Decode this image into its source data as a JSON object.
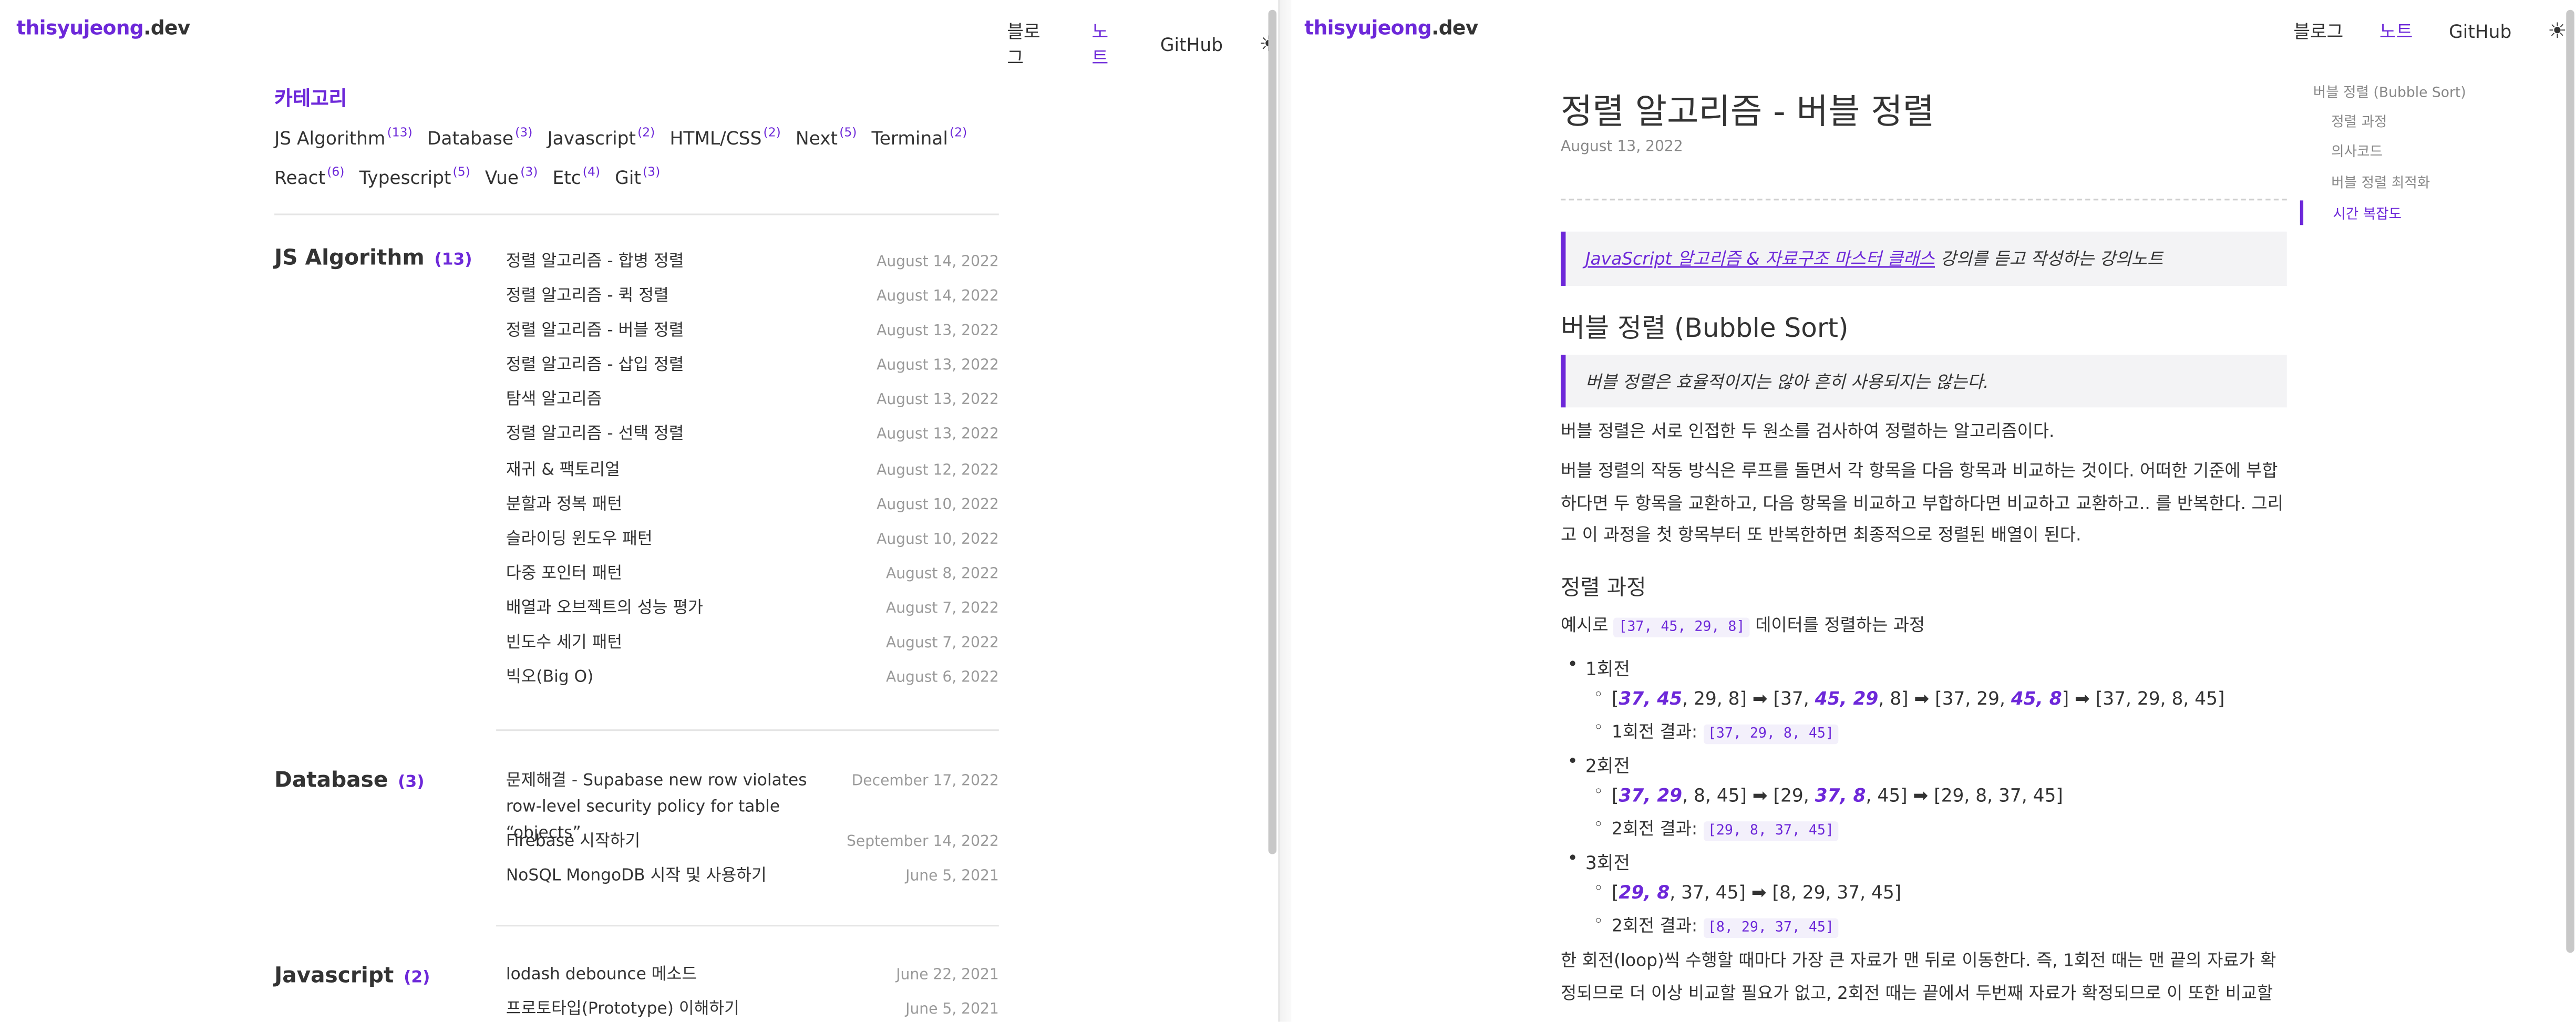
{
  "left": {
    "logo_primary": "thisyujeong",
    "logo_suffix": ".dev",
    "nav": {
      "blog": "블로그",
      "notes": "노트",
      "github": "GitHub",
      "theme_icon": "☀"
    },
    "category_title": "카테고리",
    "categories": [
      {
        "name": "JS Algorithm",
        "count": "(13)"
      },
      {
        "name": "Database",
        "count": "(3)"
      },
      {
        "name": "Javascript",
        "count": "(2)"
      },
      {
        "name": "HTML/CSS",
        "count": "(2)"
      },
      {
        "name": "Next",
        "count": "(5)"
      },
      {
        "name": "Terminal",
        "count": "(2)"
      },
      {
        "name": "React",
        "count": "(6)"
      },
      {
        "name": "Typescript",
        "count": "(5)"
      },
      {
        "name": "Vue",
        "count": "(3)"
      },
      {
        "name": "Etc",
        "count": "(4)"
      },
      {
        "name": "Git",
        "count": "(3)"
      }
    ],
    "sections": [
      {
        "name": "JS Algorithm",
        "count": "(13)",
        "posts": [
          {
            "title": "정렬 알고리즘 - 합병 정렬",
            "date": "August 14, 2022"
          },
          {
            "title": "정렬 알고리즘 - 퀵 정렬",
            "date": "August 14, 2022"
          },
          {
            "title": "정렬 알고리즘 - 버블 정렬",
            "date": "August 13, 2022"
          },
          {
            "title": "정렬 알고리즘 - 삽입 정렬",
            "date": "August 13, 2022"
          },
          {
            "title": "탐색 알고리즘",
            "date": "August 13, 2022"
          },
          {
            "title": "정렬 알고리즘 - 선택 정렬",
            "date": "August 13, 2022"
          },
          {
            "title": "재귀 & 팩토리얼",
            "date": "August 12, 2022"
          },
          {
            "title": "분할과 정복 패턴",
            "date": "August 10, 2022"
          },
          {
            "title": "슬라이딩 윈도우 패턴",
            "date": "August 10, 2022"
          },
          {
            "title": "다중 포인터 패턴",
            "date": "August 8, 2022"
          },
          {
            "title": "배열과 오브젝트의 성능 평가",
            "date": "August 7, 2022"
          },
          {
            "title": "빈도수 세기 패턴",
            "date": "August 7, 2022"
          },
          {
            "title": "빅오(Big O)",
            "date": "August 6, 2022"
          }
        ]
      },
      {
        "name": "Database",
        "count": "(3)",
        "posts": [
          {
            "title": "문제해결 - Supabase new row violates row-level security policy for table “objects”",
            "date": "December 17, 2022"
          },
          {
            "title": "Firebase 시작하기",
            "date": "September 14, 2022"
          },
          {
            "title": "NoSQL MongoDB 시작 및 사용하기",
            "date": "June 5, 2021"
          }
        ]
      },
      {
        "name": "Javascript",
        "count": "(2)",
        "posts": [
          {
            "title": "lodash debounce 메소드",
            "date": "June 22, 2021"
          },
          {
            "title": "프로토타입(Prototype) 이해하기",
            "date": "June 5, 2021"
          }
        ]
      }
    ]
  },
  "right": {
    "logo_primary": "thisyujeong",
    "logo_suffix": ".dev",
    "nav": {
      "blog": "블로그",
      "notes": "노트",
      "github": "GitHub",
      "theme_icon": "☀"
    },
    "title": "정렬 알고리즘 - 버블 정렬",
    "date": "August 13, 2022",
    "intro_link": "JavaScript 알고리즘 & 자료구조 마스터 클래스",
    "intro_rest": " 강의를 듣고 작성하는 강의노트",
    "h2": "버블 정렬 (Bubble Sort)",
    "quote": "버블 정렬은 효율적이지는 않아 흔히 사용되지는 않는다.",
    "p1": "버블 정렬은 서로 인접한 두 원소를 검사하여 정렬하는 알고리즘이다.",
    "p2": "버블 정렬의 작동 방식은 루프를 돌면서 각 항목을 다음 항목과 비교하는 것이다. 어떠한 기준에 부합하다면 두 항목을 교환하고, 다음 항목을 비교하고 부합하다면 비교하고 교환하고.. 를 반복한다. 그리고 이 과정을 첫 항목부터 또 반복한하면 최종적으로 정렬된 배열이 된다.",
    "h3": "정렬 과정",
    "example_pre": "예시로 ",
    "example_code": "[37, 45, 29, 8]",
    "example_post": " 데이터를 정렬하는 과정",
    "round1": "1회전",
    "round1_result_label": "1회전 결과: ",
    "round1_result": "[37, 29, 8, 45]",
    "round2": "2회전",
    "round2_result_label": "2회전 결과: ",
    "round2_result": "[29, 8, 37, 45]",
    "round3": "3회전",
    "round3_result_label": "2회전 결과: ",
    "round3_result": "[8, 29, 37, 45]",
    "p3": "한 회전(loop)씩 수행할 때마다 가장 큰 자료가 맨 뒤로 이동한다. 즉, 1회전 때는 맨 끝의 자료가 확정되므로 더 이상 비교할 필요가 없고, 2회전 때는 끝에서 두번째 자료가 확정되므로 이 또한 비교할",
    "toc": [
      "버블 정렬 (Bubble Sort)",
      "정렬 과정",
      "의사코드",
      "버블 정렬 최적화",
      "시간 복잡도"
    ],
    "colors": {
      "accent": "#6d28d9"
    }
  }
}
